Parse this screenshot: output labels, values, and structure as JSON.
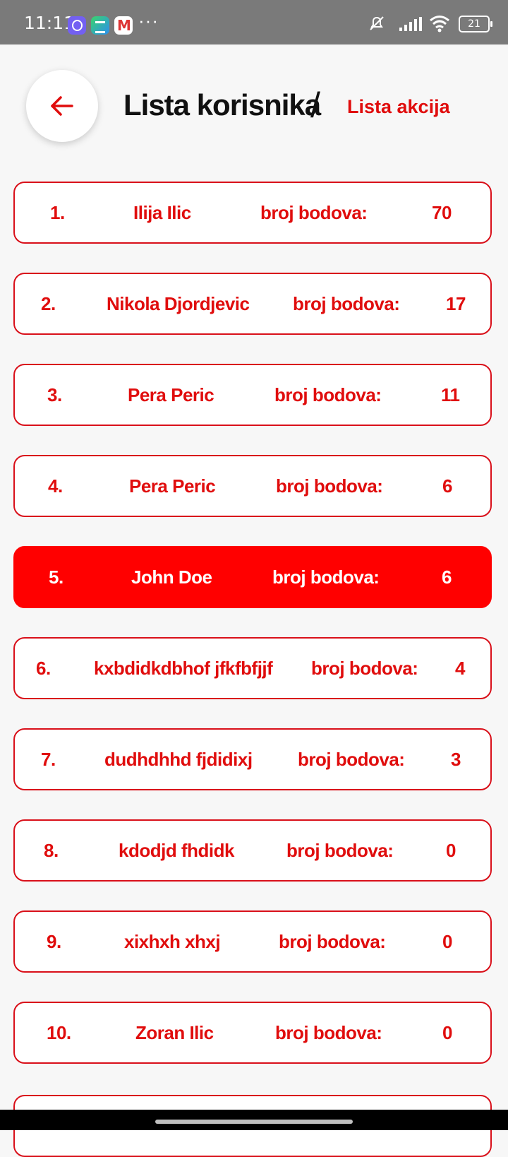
{
  "status_bar": {
    "time": "11:11",
    "icons": [
      "viber-icon",
      "stack-app-icon",
      "gmail-icon",
      "more-icon",
      "mute-icon",
      "signal-icon",
      "wifi-icon",
      "battery-icon"
    ],
    "more": "···",
    "battery": "21"
  },
  "header": {
    "back_icon": "arrow-left-icon",
    "title": "Lista korisnika",
    "separator": "/",
    "link": "Lista akcija"
  },
  "colors": {
    "accent": "#e00d0d",
    "active_bg": "#ff0000",
    "background": "#f7f7f7"
  },
  "users": [
    {
      "rank": "1.",
      "name": "Ilija Ilic",
      "points_label": "broj bodova:",
      "points": "70",
      "active": false
    },
    {
      "rank": "2.",
      "name": "Nikola Djordjevic",
      "points_label": "broj bodova:",
      "points": "17",
      "active": false
    },
    {
      "rank": "3.",
      "name": "Pera Peric",
      "points_label": "broj bodova:",
      "points": "11",
      "active": false
    },
    {
      "rank": "4.",
      "name": "Pera Peric",
      "points_label": "broj bodova:",
      "points": "6",
      "active": false
    },
    {
      "rank": "5.",
      "name": "John Doe",
      "points_label": "broj bodova:",
      "points": "6",
      "active": true
    },
    {
      "rank": "6.",
      "name": "kxbdidkdbhof jfkfbfjjf",
      "points_label": "broj bodova:",
      "points": "4",
      "active": false
    },
    {
      "rank": "7.",
      "name": "dudhdhhd fjdidixj",
      "points_label": "broj bodova:",
      "points": "3",
      "active": false
    },
    {
      "rank": "8.",
      "name": "kdodjd fhdidk",
      "points_label": "broj bodova:",
      "points": "0",
      "active": false
    },
    {
      "rank": "9.",
      "name": "xixhxh xhxj",
      "points_label": "broj bodova:",
      "points": "0",
      "active": false
    },
    {
      "rank": "10.",
      "name": "Zoran Ilic",
      "points_label": "broj bodova:",
      "points": "0",
      "active": false
    }
  ]
}
